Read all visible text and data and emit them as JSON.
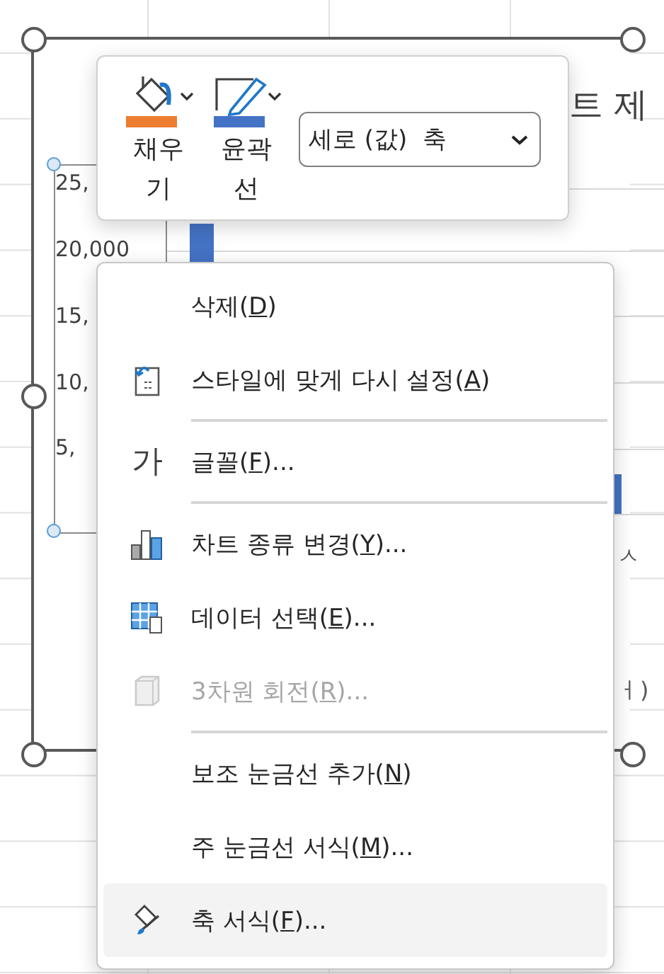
{
  "chart": {
    "title_fragment": "트 제",
    "axis_labels": [
      "25,",
      "20,000",
      "15,",
      "10,",
      "5,"
    ],
    "right_fragments": [
      "ㅅ",
      "ㅓ)"
    ]
  },
  "mini_toolbar": {
    "buttons": [
      {
        "kind": "fill",
        "label": "채우기",
        "color": "#ed7d31"
      },
      {
        "kind": "outline",
        "label": "윤곽선",
        "color": "#4472c4"
      }
    ],
    "element_dropdown": {
      "value": "세로 (값)  축"
    }
  },
  "context_menu": {
    "items": [
      {
        "kind": "item",
        "before": "삭제(",
        "key": "D",
        "after": ")",
        "disabled": false,
        "highlighted": false
      },
      {
        "kind": "item",
        "before": "스타일에 맞게 다시 설정(",
        "key": "A",
        "after": ")",
        "disabled": false,
        "highlighted": false
      },
      {
        "kind": "separator"
      },
      {
        "kind": "item",
        "glyph": "가",
        "before": "글꼴(",
        "key": "F",
        "after": ")...",
        "disabled": false,
        "highlighted": false
      },
      {
        "kind": "separator"
      },
      {
        "kind": "item",
        "before": "차트 종류 변경(",
        "key": "Y",
        "after": ")...",
        "disabled": false,
        "highlighted": false
      },
      {
        "kind": "item",
        "before": "데이터 선택(",
        "key": "E",
        "after": ")...",
        "disabled": false,
        "highlighted": false
      },
      {
        "kind": "item",
        "before": "3차원 회전(",
        "key": "R",
        "after": ")...",
        "disabled": true,
        "highlighted": false
      },
      {
        "kind": "separator"
      },
      {
        "kind": "item",
        "before": "보조 눈금선 추가(",
        "key": "N",
        "after": ")",
        "disabled": false,
        "highlighted": false
      },
      {
        "kind": "item",
        "before": "주 눈금선 서식(",
        "key": "M",
        "after": ")...",
        "disabled": false,
        "highlighted": false
      },
      {
        "kind": "item",
        "before": "축 서식(",
        "key": "F",
        "after": ")...",
        "disabled": false,
        "highlighted": true
      }
    ]
  }
}
